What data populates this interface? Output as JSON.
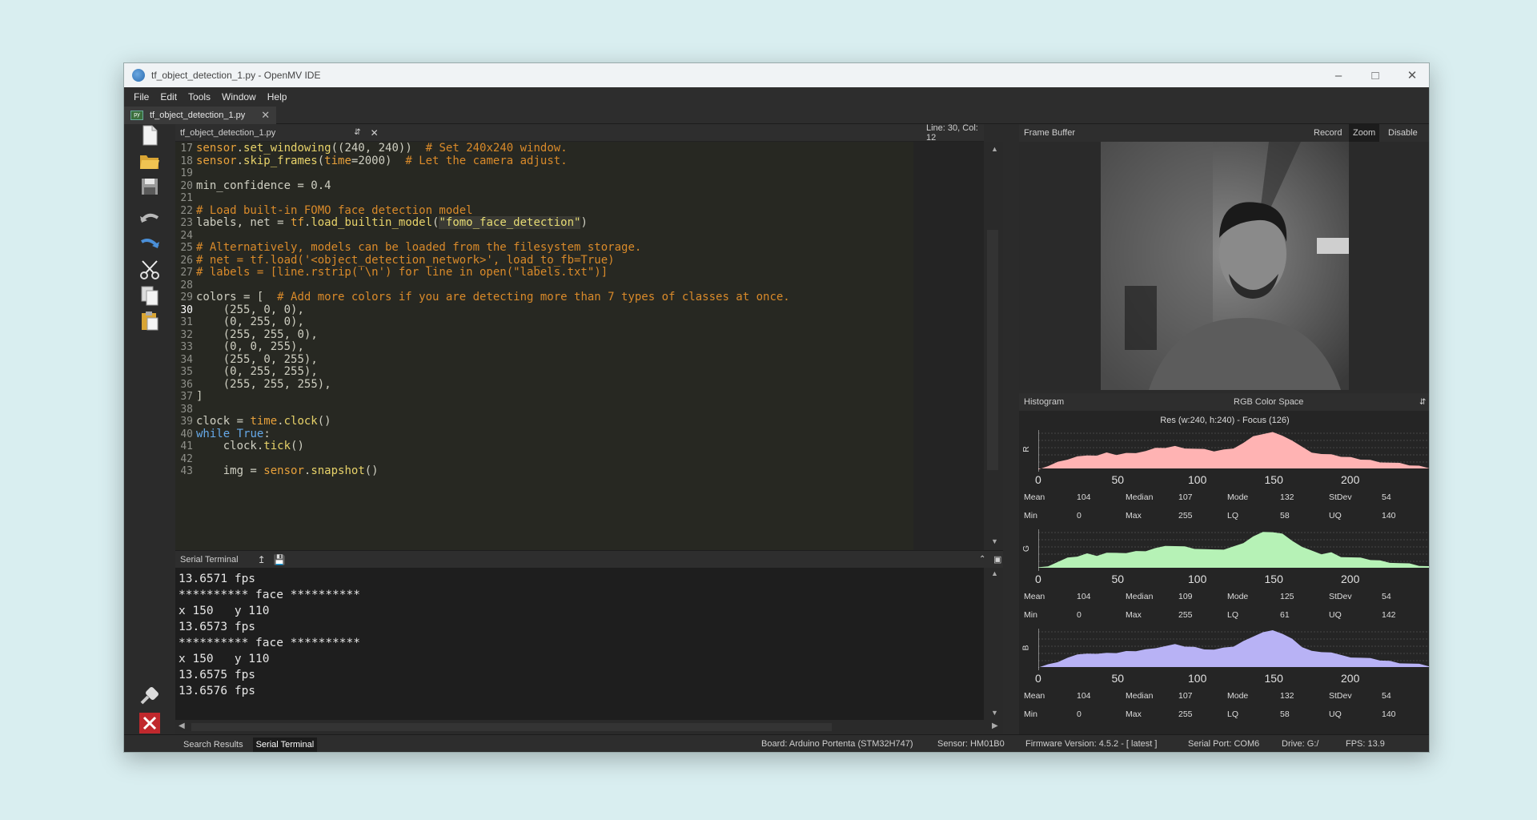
{
  "window": {
    "title": "tf_object_detection_1.py - OpenMV IDE"
  },
  "menu": [
    "File",
    "Edit",
    "Tools",
    "Window",
    "Help"
  ],
  "file_tab": "tf_object_detection_1.py",
  "editor": {
    "filename": "tf_object_detection_1.py",
    "cursor": "Line: 30, Col: 12",
    "lines": [
      {
        "n": "17",
        "code": "sensor.set_windowing((240, 240))  # Set 240x240 window."
      },
      {
        "n": "18",
        "code": "sensor.skip_frames(time=2000)  # Let the camera adjust."
      },
      {
        "n": "19",
        "code": ""
      },
      {
        "n": "20",
        "code": "min_confidence = 0.4"
      },
      {
        "n": "21",
        "code": ""
      },
      {
        "n": "22",
        "code": "# Load built-in FOMO face detection model"
      },
      {
        "n": "23",
        "code": "labels, net = tf.load_builtin_model(\"fomo_face_detection\")"
      },
      {
        "n": "24",
        "code": ""
      },
      {
        "n": "25",
        "code": "# Alternatively, models can be loaded from the filesystem storage."
      },
      {
        "n": "26",
        "code": "# net = tf.load('<object_detection_network>', load_to_fb=True)"
      },
      {
        "n": "27",
        "code": "# labels = [line.rstrip('\\n') for line in open(\"labels.txt\")]"
      },
      {
        "n": "28",
        "code": ""
      },
      {
        "n": "29",
        "code": "colors = [  # Add more colors if you are detecting more than 7 types of classes at once."
      },
      {
        "n": "30",
        "code": "    (255, 0, 0),"
      },
      {
        "n": "31",
        "code": "    (0, 255, 0),"
      },
      {
        "n": "32",
        "code": "    (255, 255, 0),"
      },
      {
        "n": "33",
        "code": "    (0, 0, 255),"
      },
      {
        "n": "34",
        "code": "    (255, 0, 255),"
      },
      {
        "n": "35",
        "code": "    (0, 255, 255),"
      },
      {
        "n": "36",
        "code": "    (255, 255, 255),"
      },
      {
        "n": "37",
        "code": "]"
      },
      {
        "n": "38",
        "code": ""
      },
      {
        "n": "39",
        "code": "clock = time.clock()"
      },
      {
        "n": "40",
        "code": "while True:"
      },
      {
        "n": "41",
        "code": "    clock.tick()"
      },
      {
        "n": "42",
        "code": ""
      },
      {
        "n": "43",
        "code": "    img = sensor.snapshot()"
      }
    ]
  },
  "terminal": {
    "title": "Serial Terminal",
    "lines": [
      "13.6571 fps",
      "********** face **********",
      "x 150   y 110",
      "13.6573 fps",
      "********** face **********",
      "x 150   y 110",
      "13.6575 fps",
      "13.6576 fps"
    ]
  },
  "bottom_tabs": [
    "Search Results",
    "Serial Terminal"
  ],
  "status": {
    "board": "Board: Arduino Portenta (STM32H747)",
    "sensor": "Sensor: HM01B0",
    "firmware": "Firmware Version: 4.5.2 - [ latest ]",
    "port": "Serial Port: COM6",
    "drive": "Drive: G:/",
    "fps": "FPS: 13.9"
  },
  "frame_buffer": {
    "title": "Frame Buffer",
    "buttons": [
      "Record",
      "Zoom",
      "Disable"
    ]
  },
  "histogram": {
    "title": "Histogram",
    "color_space": "RGB Color Space",
    "resolution": "Res (w:240, h:240) - Focus (126)",
    "ticks": [
      "0",
      "50",
      "100",
      "150",
      "200"
    ],
    "channels": [
      {
        "label": "R",
        "color": "#ffb3b3",
        "stats": {
          "Mean": "104",
          "Median": "107",
          "Mode": "132",
          "StDev": "54",
          "Min": "0",
          "Max": "255",
          "LQ": "58",
          "UQ": "140"
        }
      },
      {
        "label": "G",
        "color": "#b6f2b6",
        "stats": {
          "Mean": "104",
          "Median": "109",
          "Mode": "125",
          "StDev": "54",
          "Min": "0",
          "Max": "255",
          "LQ": "61",
          "UQ": "142"
        }
      },
      {
        "label": "B",
        "color": "#b8b2f5",
        "stats": {
          "Mean": "104",
          "Median": "107",
          "Mode": "132",
          "StDev": "54",
          "Min": "0",
          "Max": "255",
          "LQ": "58",
          "UQ": "140"
        }
      }
    ]
  }
}
